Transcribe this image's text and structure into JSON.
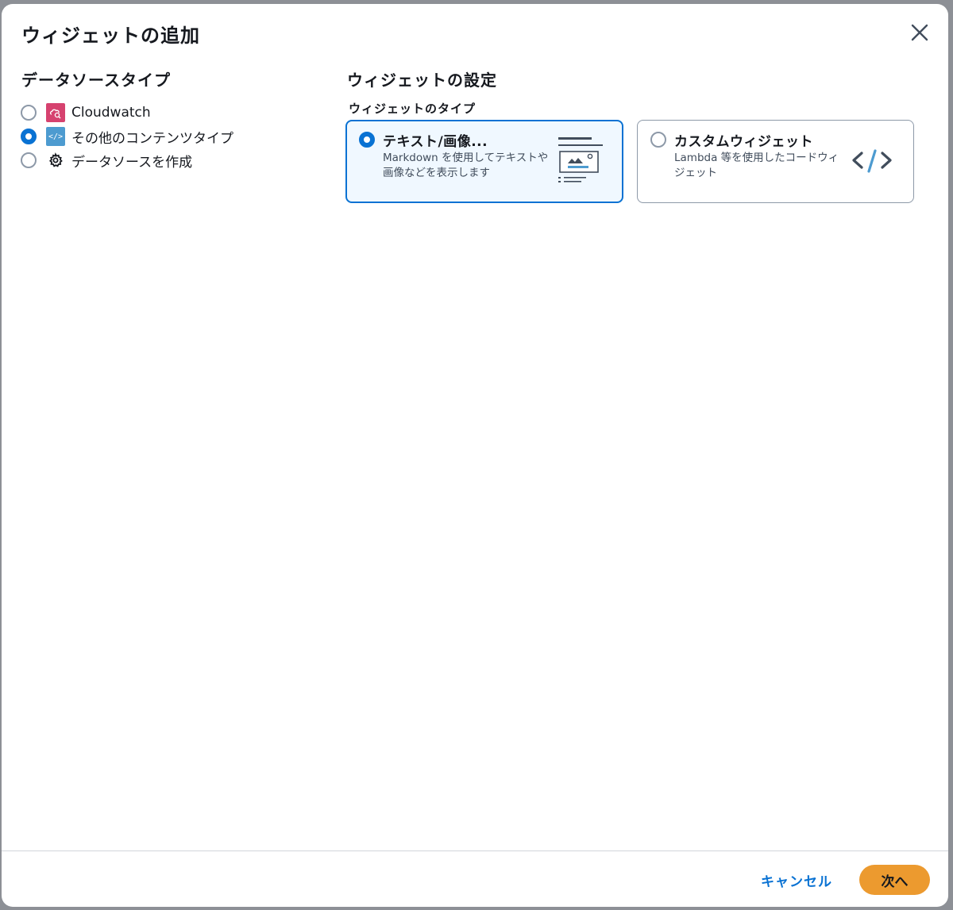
{
  "modal": {
    "title": "ウィジェットの追加",
    "close_icon": "close-icon"
  },
  "data_source": {
    "title": "データソースタイプ",
    "items": [
      {
        "label": "Cloudwatch",
        "icon": "cloudwatch-icon",
        "selected": false
      },
      {
        "label": "その他のコンテンツタイプ",
        "icon": "code-icon",
        "selected": true
      },
      {
        "label": "データソースを作成",
        "icon": "gear-icon",
        "selected": false
      }
    ]
  },
  "widget_settings": {
    "title": "ウィジェットの設定",
    "type_label": "ウィジェットのタイプ",
    "options": [
      {
        "title": "テキスト/画像...",
        "description": "Markdown を使用してテキストや画像などを表示します",
        "icon": "text-image-icon",
        "selected": true
      },
      {
        "title": "カスタムウィジェット",
        "description": "Lambda 等を使用したコードウィジェット",
        "icon": "code-brackets-icon",
        "selected": false
      }
    ]
  },
  "footer": {
    "cancel_label": "キャンセル",
    "next_label": "次へ"
  },
  "colors": {
    "accent": "#0972d3",
    "primary_button": "#ec9a2f",
    "cloudwatch": "#d6426f",
    "code_icon": "#4d9bd0"
  }
}
